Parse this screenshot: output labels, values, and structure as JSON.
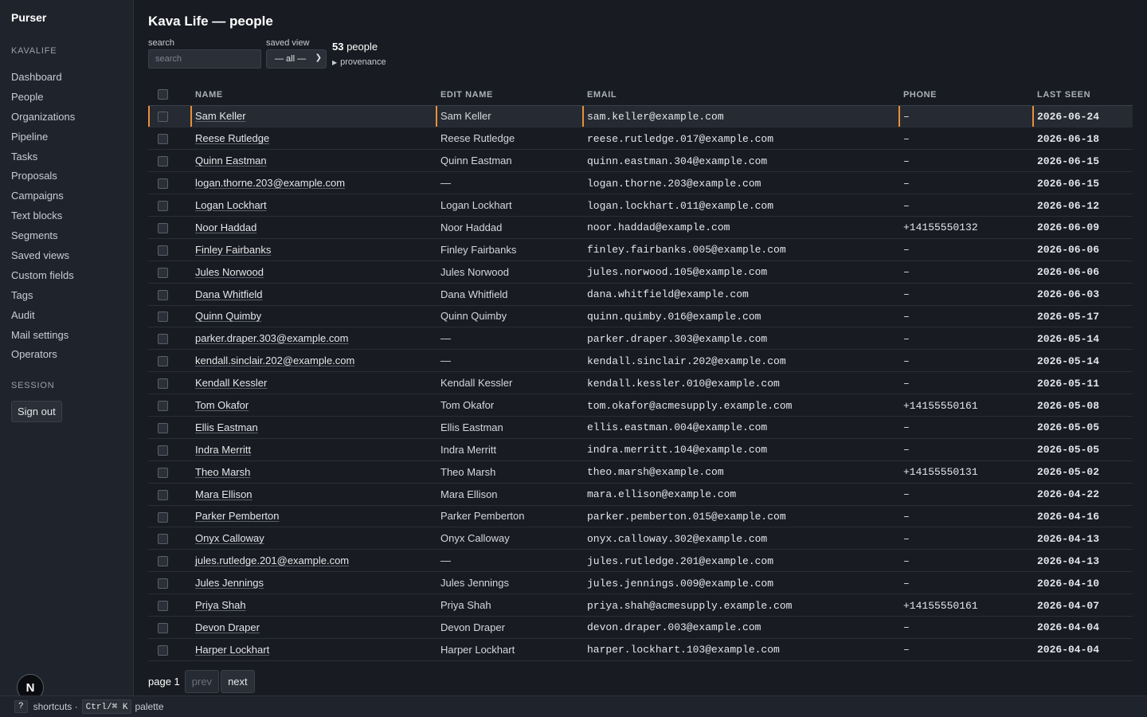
{
  "app": {
    "brand": "Purser"
  },
  "sidebar": {
    "workspace_label": "KAVALIFE",
    "items": [
      {
        "label": "Dashboard"
      },
      {
        "label": "People"
      },
      {
        "label": "Organizations"
      },
      {
        "label": "Pipeline"
      },
      {
        "label": "Tasks"
      },
      {
        "label": "Proposals"
      },
      {
        "label": "Campaigns"
      },
      {
        "label": "Text blocks"
      },
      {
        "label": "Segments"
      },
      {
        "label": "Saved views"
      },
      {
        "label": "Custom fields"
      },
      {
        "label": "Tags"
      },
      {
        "label": "Audit"
      },
      {
        "label": "Mail settings"
      },
      {
        "label": "Operators"
      }
    ],
    "session_label": "SESSION",
    "sign_out_label": "Sign out"
  },
  "header": {
    "title": "Kava Life — people",
    "search_label": "search",
    "search_placeholder": "search",
    "search_value": "",
    "saved_view_label": "saved view",
    "saved_view_value": "— all —",
    "count_number": "53",
    "count_suffix": " people",
    "provenance_label": "provenance"
  },
  "table": {
    "columns": [
      "NAME",
      "EDIT NAME",
      "EMAIL",
      "PHONE",
      "LAST SEEN"
    ],
    "rows": [
      {
        "name": "Sam Keller",
        "edit_name": "Sam Keller",
        "email": "sam.keller@example.com",
        "phone": "–",
        "last_seen": "2026-06-24"
      },
      {
        "name": "Reese Rutledge",
        "edit_name": "Reese Rutledge",
        "email": "reese.rutledge.017@example.com",
        "phone": "–",
        "last_seen": "2026-06-18"
      },
      {
        "name": "Quinn Eastman",
        "edit_name": "Quinn Eastman",
        "email": "quinn.eastman.304@example.com",
        "phone": "–",
        "last_seen": "2026-06-15"
      },
      {
        "name": "logan.thorne.203@example.com",
        "edit_name": "—",
        "email": "logan.thorne.203@example.com",
        "phone": "–",
        "last_seen": "2026-06-15"
      },
      {
        "name": "Logan Lockhart",
        "edit_name": "Logan Lockhart",
        "email": "logan.lockhart.011@example.com",
        "phone": "–",
        "last_seen": "2026-06-12"
      },
      {
        "name": "Noor Haddad",
        "edit_name": "Noor Haddad",
        "email": "noor.haddad@example.com",
        "phone": "+14155550132",
        "last_seen": "2026-06-09"
      },
      {
        "name": "Finley Fairbanks",
        "edit_name": "Finley Fairbanks",
        "email": "finley.fairbanks.005@example.com",
        "phone": "–",
        "last_seen": "2026-06-06"
      },
      {
        "name": "Jules Norwood",
        "edit_name": "Jules Norwood",
        "email": "jules.norwood.105@example.com",
        "phone": "–",
        "last_seen": "2026-06-06"
      },
      {
        "name": "Dana Whitfield",
        "edit_name": "Dana Whitfield",
        "email": "dana.whitfield@example.com",
        "phone": "–",
        "last_seen": "2026-06-03"
      },
      {
        "name": "Quinn Quimby",
        "edit_name": "Quinn Quimby",
        "email": "quinn.quimby.016@example.com",
        "phone": "–",
        "last_seen": "2026-05-17"
      },
      {
        "name": "parker.draper.303@example.com",
        "edit_name": "—",
        "email": "parker.draper.303@example.com",
        "phone": "–",
        "last_seen": "2026-05-14"
      },
      {
        "name": "kendall.sinclair.202@example.com",
        "edit_name": "—",
        "email": "kendall.sinclair.202@example.com",
        "phone": "–",
        "last_seen": "2026-05-14"
      },
      {
        "name": "Kendall Kessler",
        "edit_name": "Kendall Kessler",
        "email": "kendall.kessler.010@example.com",
        "phone": "–",
        "last_seen": "2026-05-11"
      },
      {
        "name": "Tom Okafor",
        "edit_name": "Tom Okafor",
        "email": "tom.okafor@acmesupply.example.com",
        "phone": "+14155550161",
        "last_seen": "2026-05-08"
      },
      {
        "name": "Ellis Eastman",
        "edit_name": "Ellis Eastman",
        "email": "ellis.eastman.004@example.com",
        "phone": "–",
        "last_seen": "2026-05-05"
      },
      {
        "name": "Indra Merritt",
        "edit_name": "Indra Merritt",
        "email": "indra.merritt.104@example.com",
        "phone": "–",
        "last_seen": "2026-05-05"
      },
      {
        "name": "Theo Marsh",
        "edit_name": "Theo Marsh",
        "email": "theo.marsh@example.com",
        "phone": "+14155550131",
        "last_seen": "2026-05-02"
      },
      {
        "name": "Mara Ellison",
        "edit_name": "Mara Ellison",
        "email": "mara.ellison@example.com",
        "phone": "–",
        "last_seen": "2026-04-22"
      },
      {
        "name": "Parker Pemberton",
        "edit_name": "Parker Pemberton",
        "email": "parker.pemberton.015@example.com",
        "phone": "–",
        "last_seen": "2026-04-16"
      },
      {
        "name": "Onyx Calloway",
        "edit_name": "Onyx Calloway",
        "email": "onyx.calloway.302@example.com",
        "phone": "–",
        "last_seen": "2026-04-13"
      },
      {
        "name": "jules.rutledge.201@example.com",
        "edit_name": "—",
        "email": "jules.rutledge.201@example.com",
        "phone": "–",
        "last_seen": "2026-04-13"
      },
      {
        "name": "Jules Jennings",
        "edit_name": "Jules Jennings",
        "email": "jules.jennings.009@example.com",
        "phone": "–",
        "last_seen": "2026-04-10"
      },
      {
        "name": "Priya Shah",
        "edit_name": "Priya Shah",
        "email": "priya.shah@acmesupply.example.com",
        "phone": "+14155550161",
        "last_seen": "2026-04-07"
      },
      {
        "name": "Devon Draper",
        "edit_name": "Devon Draper",
        "email": "devon.draper.003@example.com",
        "phone": "–",
        "last_seen": "2026-04-04"
      },
      {
        "name": "Harper Lockhart",
        "edit_name": "Harper Lockhart",
        "email": "harper.lockhart.103@example.com",
        "phone": "–",
        "last_seen": "2026-04-04"
      }
    ]
  },
  "pager": {
    "page_label": "page 1",
    "prev_label": "prev",
    "next_label": "next"
  },
  "fab": {
    "label": "N"
  },
  "footer": {
    "shortcuts_key": "?",
    "shortcuts_label": "shortcuts ·",
    "palette_key": "Ctrl/⌘ K",
    "palette_label": "palette"
  },
  "colors": {
    "accent": "#e8913a",
    "background": "#181b21",
    "sidebar": "#1f232b"
  }
}
